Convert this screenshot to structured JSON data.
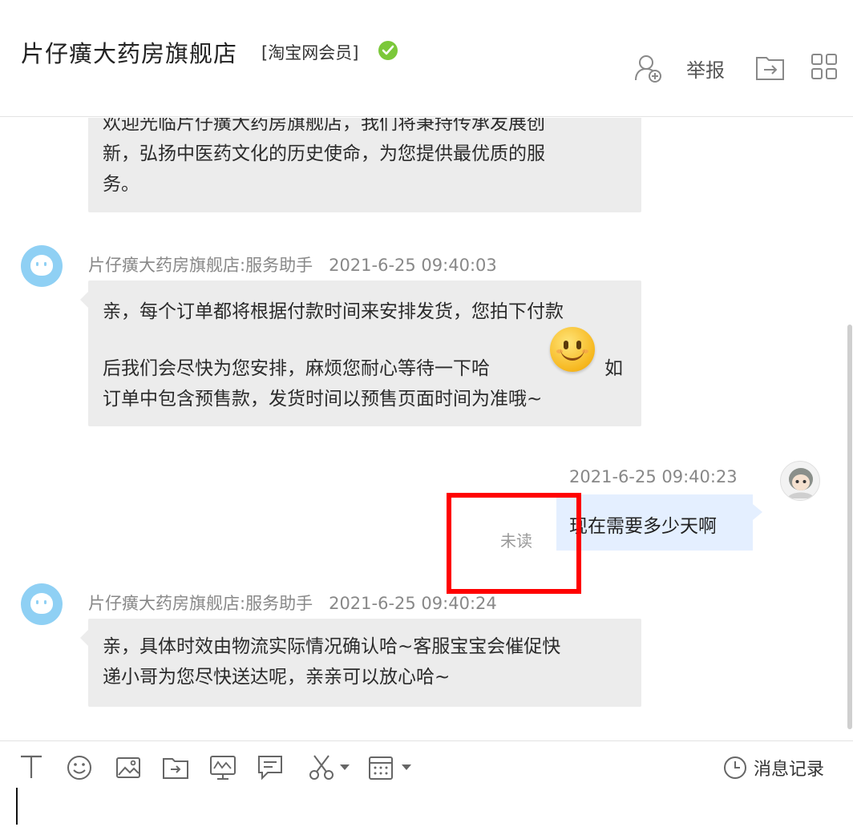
{
  "header": {
    "shop_name": "片仔癀大药房旗舰店",
    "member_tag": "[淘宝网会员]",
    "report_label": "举报",
    "colors": {
      "verified": "#7bc83a"
    }
  },
  "chat": {
    "messages": [
      {
        "lines": [
          "欢迎光临片仔癀大药房旗舰店，我们将秉持传承发展创",
          "新，弘扬中医药文化的历史使命，为您提供最优质的服",
          "务。"
        ]
      },
      {
        "sender": "片仔癀大药房旗舰店:服务助手",
        "time": "2021-6-25 09:40:03",
        "line1": "亲，每个订单都将根据付款时间来安排发货，您拍下付款",
        "line2": "后我们会尽快为您安排，麻烦您耐心等待一下哈",
        "line2b": "如",
        "line3": "订单中包含预售款，发货时间以预售页面时间为准哦~"
      },
      {
        "self": true,
        "time": "2021-6-25 09:40:23",
        "text": "现在需要多少天啊",
        "status": "未读"
      },
      {
        "sender": "片仔癀大药房旗舰店:服务助手",
        "time": "2021-6-25 09:40:24",
        "lines": [
          "亲，具体时效由物流实际情况确认哈~客服宝宝会催促快",
          "递小哥为您尽快送达呢，亲亲可以放心哈~"
        ]
      }
    ]
  },
  "toolbar": {
    "history_label": "消息记录"
  },
  "colors": {
    "annotation_box": "#ff0000",
    "self_bubble": "#e4efff",
    "other_bubble": "#ececec"
  }
}
